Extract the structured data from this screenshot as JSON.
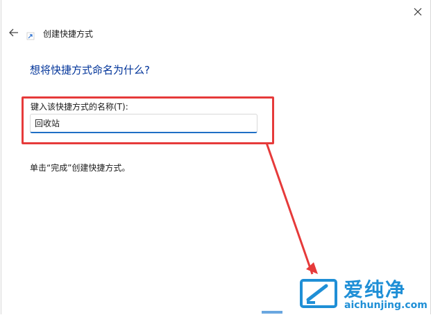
{
  "window": {
    "title": "创建快捷方式"
  },
  "page": {
    "heading": "想将快捷方式命名为什么?",
    "field_label": "键入该快捷方式的名称(T):",
    "field_value": "回收站",
    "instruction": "单击“完成”创建快捷方式。"
  },
  "watermark": {
    "brand": "爱纯净",
    "url": "aichunjing.com"
  },
  "colors": {
    "heading": "#003399",
    "highlight": "#e63a3a",
    "input_accent": "#1f6fc5",
    "watermark": "#1f8fd6"
  },
  "icons": {
    "close": "close-icon",
    "back": "back-arrow-icon",
    "wizard": "shortcut-icon",
    "watermark_logo": "logo-icon"
  }
}
